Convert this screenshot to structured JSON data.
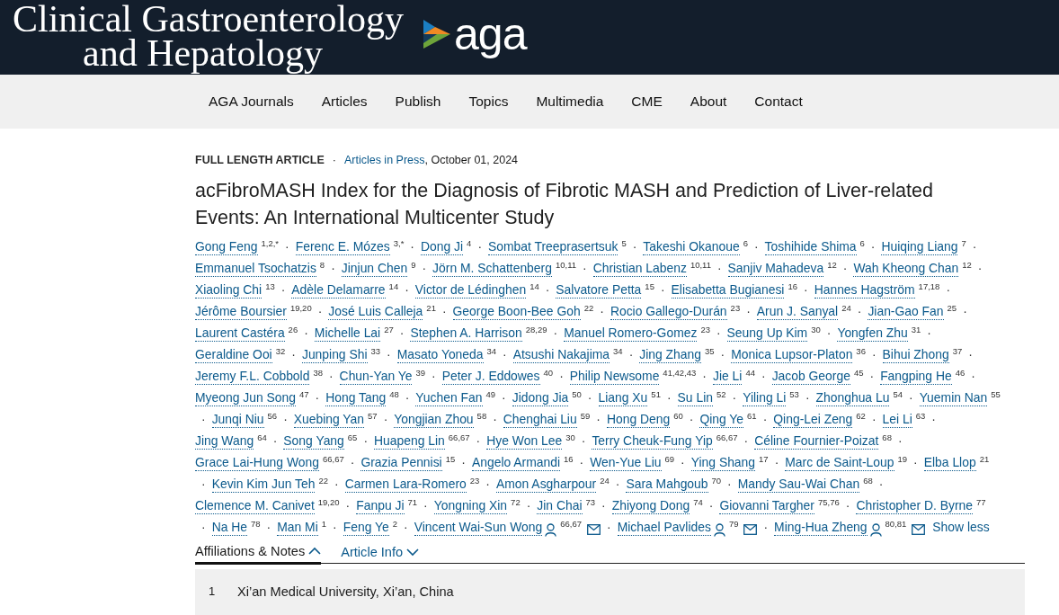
{
  "header": {
    "journal_title_lines": [
      "Clinical Gastroenterology",
      "and Hepatology"
    ],
    "logo_text": "aga"
  },
  "nav": {
    "items": [
      "AGA Journals",
      "Articles",
      "Publish",
      "Topics",
      "Multimedia",
      "CME",
      "About",
      "Contact"
    ]
  },
  "article": {
    "type_label": "FULL LENGTH ARTICLE",
    "meta_separator": "·",
    "issue_link": "Articles in Press",
    "date": ", October 01, 2024",
    "title": "acFibroMASH Index for the Diagnosis of Fibrotic MASH and Prediction of Liver-related Events: An International Multicenter Study",
    "author_separator": "·",
    "author_lines": [
      {
        "lead": false,
        "trail": true,
        "authors": [
          {
            "name": "Gong Feng",
            "sup": "1,2,*"
          },
          {
            "name": "Ferenc E. Mózes",
            "sup": "3,*"
          },
          {
            "name": "Dong Ji",
            "sup": "4"
          },
          {
            "name": "Sombat Treeprasertsuk",
            "sup": "5"
          },
          {
            "name": "Takeshi Okanoue",
            "sup": "6"
          },
          {
            "name": "Toshihide Shima",
            "sup": "6"
          },
          {
            "name": "Huiqing Liang",
            "sup": "7"
          }
        ]
      },
      {
        "lead": false,
        "trail": true,
        "authors": [
          {
            "name": "Emmanuel Tsochatzis",
            "sup": "8"
          },
          {
            "name": "Jinjun Chen",
            "sup": "9"
          },
          {
            "name": "Jörn M. Schattenberg",
            "sup": "10,11"
          },
          {
            "name": "Christian Labenz",
            "sup": "10,11"
          },
          {
            "name": "Sanjiv Mahadeva",
            "sup": "12"
          },
          {
            "name": "Wah Kheong Chan",
            "sup": "12"
          }
        ]
      },
      {
        "lead": false,
        "trail": true,
        "authors": [
          {
            "name": "Xiaoling Chi",
            "sup": "13"
          },
          {
            "name": "Adèle Delamarre",
            "sup": "14"
          },
          {
            "name": "Victor de Lédinghen",
            "sup": "14"
          },
          {
            "name": "Salvatore Petta",
            "sup": "15"
          },
          {
            "name": "Elisabetta Bugianesi",
            "sup": "16"
          },
          {
            "name": "Hannes Hagström",
            "sup": "17,18"
          }
        ]
      },
      {
        "lead": false,
        "trail": true,
        "authors": [
          {
            "name": "Jérôme Boursier",
            "sup": "19,20"
          },
          {
            "name": "José Luis Calleja",
            "sup": "21"
          },
          {
            "name": "George Boon-Bee Goh",
            "sup": "22"
          },
          {
            "name": "Rocio Gallego-Durán",
            "sup": "23"
          },
          {
            "name": "Arun J. Sanyal",
            "sup": "24"
          },
          {
            "name": "Jian-Gao Fan",
            "sup": "25"
          }
        ]
      },
      {
        "lead": false,
        "trail": true,
        "authors": [
          {
            "name": "Laurent Castéra",
            "sup": "26"
          },
          {
            "name": "Michelle Lai",
            "sup": "27"
          },
          {
            "name": "Stephen A. Harrison",
            "sup": "28,29"
          },
          {
            "name": "Manuel Romero-Gomez",
            "sup": "23"
          },
          {
            "name": "Seung Up Kim",
            "sup": "30"
          },
          {
            "name": "Yongfen Zhu",
            "sup": "31"
          }
        ]
      },
      {
        "lead": false,
        "trail": true,
        "authors": [
          {
            "name": "Geraldine Ooi",
            "sup": "32"
          },
          {
            "name": "Junping Shi",
            "sup": "33"
          },
          {
            "name": "Masato Yoneda",
            "sup": "34"
          },
          {
            "name": "Atsushi Nakajima",
            "sup": "34"
          },
          {
            "name": "Jing Zhang",
            "sup": "35"
          },
          {
            "name": "Monica Lupsor-Platon",
            "sup": "36"
          },
          {
            "name": "Bihui Zhong",
            "sup": "37"
          }
        ]
      },
      {
        "lead": false,
        "trail": true,
        "authors": [
          {
            "name": "Jeremy F.L. Cobbold",
            "sup": "38"
          },
          {
            "name": "Chun-Yan Ye",
            "sup": "39"
          },
          {
            "name": "Peter J. Eddowes",
            "sup": "40"
          },
          {
            "name": "Philip Newsome",
            "sup": "41,42,43"
          },
          {
            "name": "Jie Li",
            "sup": "44"
          },
          {
            "name": "Jacob George",
            "sup": "45"
          },
          {
            "name": "Fangping He",
            "sup": "46"
          }
        ]
      },
      {
        "lead": false,
        "trail": false,
        "authors": [
          {
            "name": "Myeong Jun Song",
            "sup": "47"
          },
          {
            "name": "Hong Tang",
            "sup": "48"
          },
          {
            "name": "Yuchen Fan",
            "sup": "49"
          },
          {
            "name": "Jidong Jia",
            "sup": "50"
          },
          {
            "name": "Liang Xu",
            "sup": "51"
          },
          {
            "name": "Su Lin",
            "sup": "52"
          },
          {
            "name": "Yiling Li",
            "sup": "53"
          },
          {
            "name": "Zhonghua Lu",
            "sup": "54"
          },
          {
            "name": "Yuemin Nan",
            "sup": "55"
          }
        ]
      },
      {
        "lead": true,
        "trail": true,
        "authors": [
          {
            "name": "Junqi Niu",
            "sup": "56"
          },
          {
            "name": "Xuebing Yan",
            "sup": "57"
          },
          {
            "name": "Yongjian Zhou",
            "sup": "58"
          },
          {
            "name": "Chenghai Liu",
            "sup": "59"
          },
          {
            "name": "Hong Deng",
            "sup": "60"
          },
          {
            "name": "Qing Ye",
            "sup": "61"
          },
          {
            "name": "Qing-Lei Zeng",
            "sup": "62"
          },
          {
            "name": "Lei Li",
            "sup": "63"
          }
        ]
      },
      {
        "lead": false,
        "trail": true,
        "authors": [
          {
            "name": "Jing Wang",
            "sup": "64"
          },
          {
            "name": "Song Yang",
            "sup": "65"
          },
          {
            "name": "Huapeng Lin",
            "sup": "66,67"
          },
          {
            "name": "Hye Won Lee",
            "sup": "30"
          },
          {
            "name": "Terry Cheuk-Fung Yip",
            "sup": "66,67"
          },
          {
            "name": "Céline Fournier-Poizat",
            "sup": "68"
          }
        ]
      },
      {
        "lead": false,
        "trail": false,
        "authors": [
          {
            "name": "Grace Lai-Hung Wong",
            "sup": "66,67"
          },
          {
            "name": "Grazia Pennisi",
            "sup": "15"
          },
          {
            "name": "Angelo Armandi",
            "sup": "16"
          },
          {
            "name": "Wen-Yue Liu",
            "sup": "69"
          },
          {
            "name": "Ying Shang",
            "sup": "17"
          },
          {
            "name": "Marc de Saint-Loup",
            "sup": "19"
          },
          {
            "name": "Elba Llop",
            "sup": "21"
          }
        ]
      },
      {
        "lead": true,
        "trail": true,
        "authors": [
          {
            "name": "Kevin Kim Jun Teh",
            "sup": "22"
          },
          {
            "name": "Carmen Lara-Romero",
            "sup": "23"
          },
          {
            "name": "Amon Asgharpour",
            "sup": "24"
          },
          {
            "name": "Sara Mahgoub",
            "sup": "70"
          },
          {
            "name": "Mandy Sau-Wai Chan",
            "sup": "68"
          }
        ]
      },
      {
        "lead": false,
        "trail": false,
        "authors": [
          {
            "name": "Clemence M. Canivet",
            "sup": "19,20"
          },
          {
            "name": "Fanpu Ji",
            "sup": "71"
          },
          {
            "name": "Yongning Xin",
            "sup": "72"
          },
          {
            "name": "Jin Chai",
            "sup": "73"
          },
          {
            "name": "Zhiyong Dong",
            "sup": "74"
          },
          {
            "name": "Giovanni Targher",
            "sup": "75,76"
          },
          {
            "name": "Christopher D. Byrne",
            "sup": "77"
          }
        ]
      },
      {
        "lead": true,
        "trail": false,
        "authors": [
          {
            "name": "Na He",
            "sup": "78"
          },
          {
            "name": "Man Mi",
            "sup": "1"
          },
          {
            "name": "Feng Ye",
            "sup": "2"
          },
          {
            "name": "Vincent Wai-Sun Wong",
            "sup": "66,67",
            "corresponding": true
          },
          {
            "name": "Michael Pavlides",
            "sup": "79",
            "corresponding": true
          },
          {
            "name": "Ming-Hua Zheng",
            "sup": "80,81",
            "corresponding": true
          }
        ]
      }
    ],
    "show_less": "Show less",
    "tabs": [
      {
        "label": "Affiliations & Notes",
        "selected": true,
        "expanded": true
      },
      {
        "label": "Article Info",
        "selected": false,
        "expanded": false
      }
    ],
    "affiliations": [
      {
        "number": "1",
        "text": "Xi’an Medical University, Xi’an, China"
      }
    ]
  }
}
